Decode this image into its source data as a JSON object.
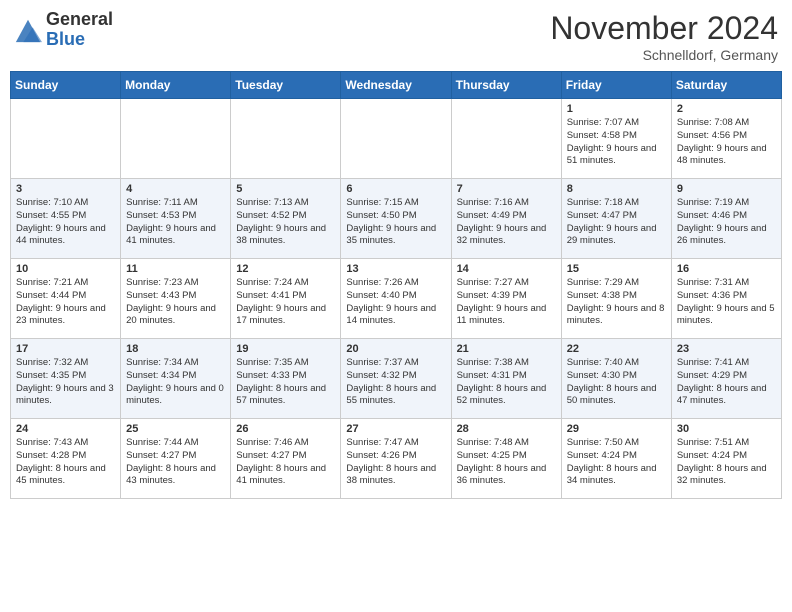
{
  "header": {
    "logo_general": "General",
    "logo_blue": "Blue",
    "month_title": "November 2024",
    "subtitle": "Schnelldorf, Germany"
  },
  "weekdays": [
    "Sunday",
    "Monday",
    "Tuesday",
    "Wednesday",
    "Thursday",
    "Friday",
    "Saturday"
  ],
  "weeks": [
    [
      {
        "day": "",
        "info": ""
      },
      {
        "day": "",
        "info": ""
      },
      {
        "day": "",
        "info": ""
      },
      {
        "day": "",
        "info": ""
      },
      {
        "day": "",
        "info": ""
      },
      {
        "day": "1",
        "info": "Sunrise: 7:07 AM\nSunset: 4:58 PM\nDaylight: 9 hours\nand 51 minutes."
      },
      {
        "day": "2",
        "info": "Sunrise: 7:08 AM\nSunset: 4:56 PM\nDaylight: 9 hours\nand 48 minutes."
      }
    ],
    [
      {
        "day": "3",
        "info": "Sunrise: 7:10 AM\nSunset: 4:55 PM\nDaylight: 9 hours\nand 44 minutes."
      },
      {
        "day": "4",
        "info": "Sunrise: 7:11 AM\nSunset: 4:53 PM\nDaylight: 9 hours\nand 41 minutes."
      },
      {
        "day": "5",
        "info": "Sunrise: 7:13 AM\nSunset: 4:52 PM\nDaylight: 9 hours\nand 38 minutes."
      },
      {
        "day": "6",
        "info": "Sunrise: 7:15 AM\nSunset: 4:50 PM\nDaylight: 9 hours\nand 35 minutes."
      },
      {
        "day": "7",
        "info": "Sunrise: 7:16 AM\nSunset: 4:49 PM\nDaylight: 9 hours\nand 32 minutes."
      },
      {
        "day": "8",
        "info": "Sunrise: 7:18 AM\nSunset: 4:47 PM\nDaylight: 9 hours\nand 29 minutes."
      },
      {
        "day": "9",
        "info": "Sunrise: 7:19 AM\nSunset: 4:46 PM\nDaylight: 9 hours\nand 26 minutes."
      }
    ],
    [
      {
        "day": "10",
        "info": "Sunrise: 7:21 AM\nSunset: 4:44 PM\nDaylight: 9 hours\nand 23 minutes."
      },
      {
        "day": "11",
        "info": "Sunrise: 7:23 AM\nSunset: 4:43 PM\nDaylight: 9 hours\nand 20 minutes."
      },
      {
        "day": "12",
        "info": "Sunrise: 7:24 AM\nSunset: 4:41 PM\nDaylight: 9 hours\nand 17 minutes."
      },
      {
        "day": "13",
        "info": "Sunrise: 7:26 AM\nSunset: 4:40 PM\nDaylight: 9 hours\nand 14 minutes."
      },
      {
        "day": "14",
        "info": "Sunrise: 7:27 AM\nSunset: 4:39 PM\nDaylight: 9 hours\nand 11 minutes."
      },
      {
        "day": "15",
        "info": "Sunrise: 7:29 AM\nSunset: 4:38 PM\nDaylight: 9 hours\nand 8 minutes."
      },
      {
        "day": "16",
        "info": "Sunrise: 7:31 AM\nSunset: 4:36 PM\nDaylight: 9 hours\nand 5 minutes."
      }
    ],
    [
      {
        "day": "17",
        "info": "Sunrise: 7:32 AM\nSunset: 4:35 PM\nDaylight: 9 hours\nand 3 minutes."
      },
      {
        "day": "18",
        "info": "Sunrise: 7:34 AM\nSunset: 4:34 PM\nDaylight: 9 hours\nand 0 minutes."
      },
      {
        "day": "19",
        "info": "Sunrise: 7:35 AM\nSunset: 4:33 PM\nDaylight: 8 hours\nand 57 minutes."
      },
      {
        "day": "20",
        "info": "Sunrise: 7:37 AM\nSunset: 4:32 PM\nDaylight: 8 hours\nand 55 minutes."
      },
      {
        "day": "21",
        "info": "Sunrise: 7:38 AM\nSunset: 4:31 PM\nDaylight: 8 hours\nand 52 minutes."
      },
      {
        "day": "22",
        "info": "Sunrise: 7:40 AM\nSunset: 4:30 PM\nDaylight: 8 hours\nand 50 minutes."
      },
      {
        "day": "23",
        "info": "Sunrise: 7:41 AM\nSunset: 4:29 PM\nDaylight: 8 hours\nand 47 minutes."
      }
    ],
    [
      {
        "day": "24",
        "info": "Sunrise: 7:43 AM\nSunset: 4:28 PM\nDaylight: 8 hours\nand 45 minutes."
      },
      {
        "day": "25",
        "info": "Sunrise: 7:44 AM\nSunset: 4:27 PM\nDaylight: 8 hours\nand 43 minutes."
      },
      {
        "day": "26",
        "info": "Sunrise: 7:46 AM\nSunset: 4:27 PM\nDaylight: 8 hours\nand 41 minutes."
      },
      {
        "day": "27",
        "info": "Sunrise: 7:47 AM\nSunset: 4:26 PM\nDaylight: 8 hours\nand 38 minutes."
      },
      {
        "day": "28",
        "info": "Sunrise: 7:48 AM\nSunset: 4:25 PM\nDaylight: 8 hours\nand 36 minutes."
      },
      {
        "day": "29",
        "info": "Sunrise: 7:50 AM\nSunset: 4:24 PM\nDaylight: 8 hours\nand 34 minutes."
      },
      {
        "day": "30",
        "info": "Sunrise: 7:51 AM\nSunset: 4:24 PM\nDaylight: 8 hours\nand 32 minutes."
      }
    ]
  ]
}
